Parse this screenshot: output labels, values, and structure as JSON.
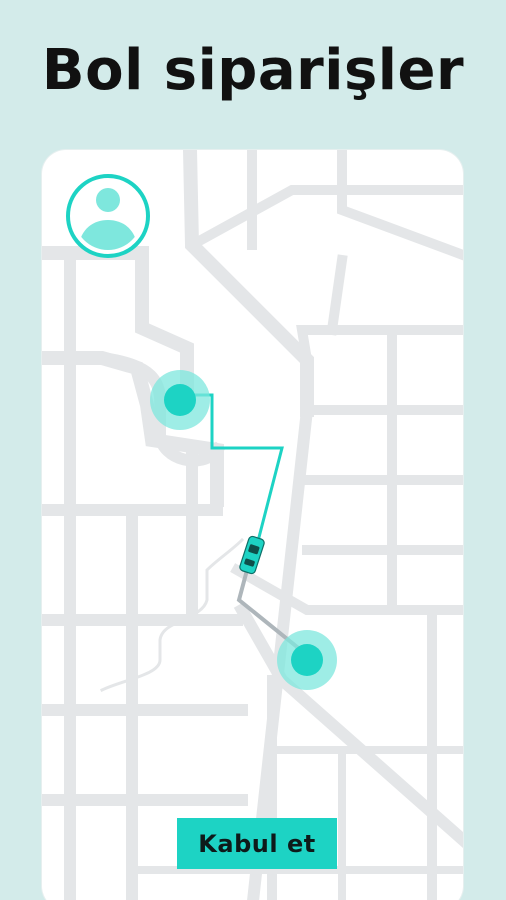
{
  "headline": "Bol siparişler",
  "map": {
    "user_avatar_icon": "user-avatar-icon",
    "pickup_marker_icon": "pickup-location-icon",
    "dropoff_marker_icon": "dropoff-location-icon",
    "vehicle_icon": "taxi-car-icon",
    "colors": {
      "accent": "#1dd3c4",
      "accent_light": "#7ee7dd",
      "road": "#e4e6e8",
      "background": "#d3ebea"
    }
  },
  "accept_button": {
    "label": "Kabul et"
  }
}
